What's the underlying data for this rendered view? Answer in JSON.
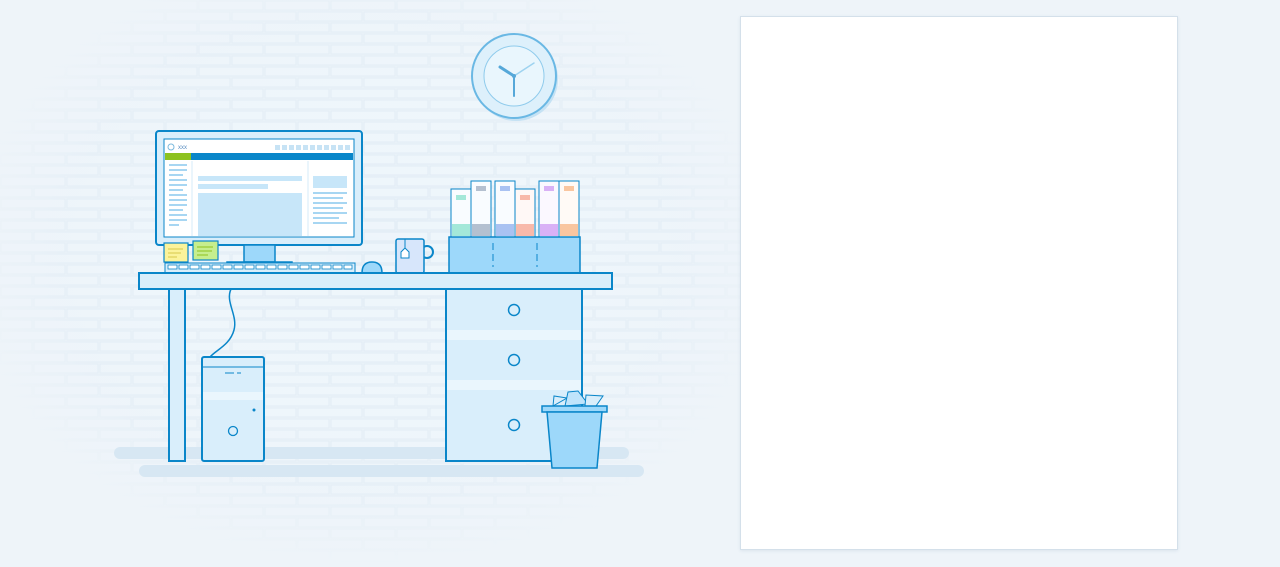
{
  "illustration": {
    "screen_app_title": "xxx",
    "colors": {
      "outline": "#0a86c9",
      "fill_light": "#d9eefb",
      "fill_mid": "#9dd8fa",
      "background": "#eef4f9",
      "accent_green": "#8dc21f",
      "accent_blue": "#0a86c9",
      "note_yellow": "#fbf39b",
      "note_green": "#c6ee8e"
    },
    "binders": [
      {
        "name": "binder-teal",
        "color": "#a4e8d9"
      },
      {
        "name": "binder-grey",
        "color": "#b4c0d0"
      },
      {
        "name": "binder-blue",
        "color": "#a9c2f2"
      },
      {
        "name": "binder-salmon",
        "color": "#f8b9aa"
      },
      {
        "name": "binder-purple",
        "color": "#d9b1f6"
      },
      {
        "name": "binder-orange",
        "color": "#f9c6a0"
      }
    ]
  },
  "panel": {
    "state": "blank"
  }
}
